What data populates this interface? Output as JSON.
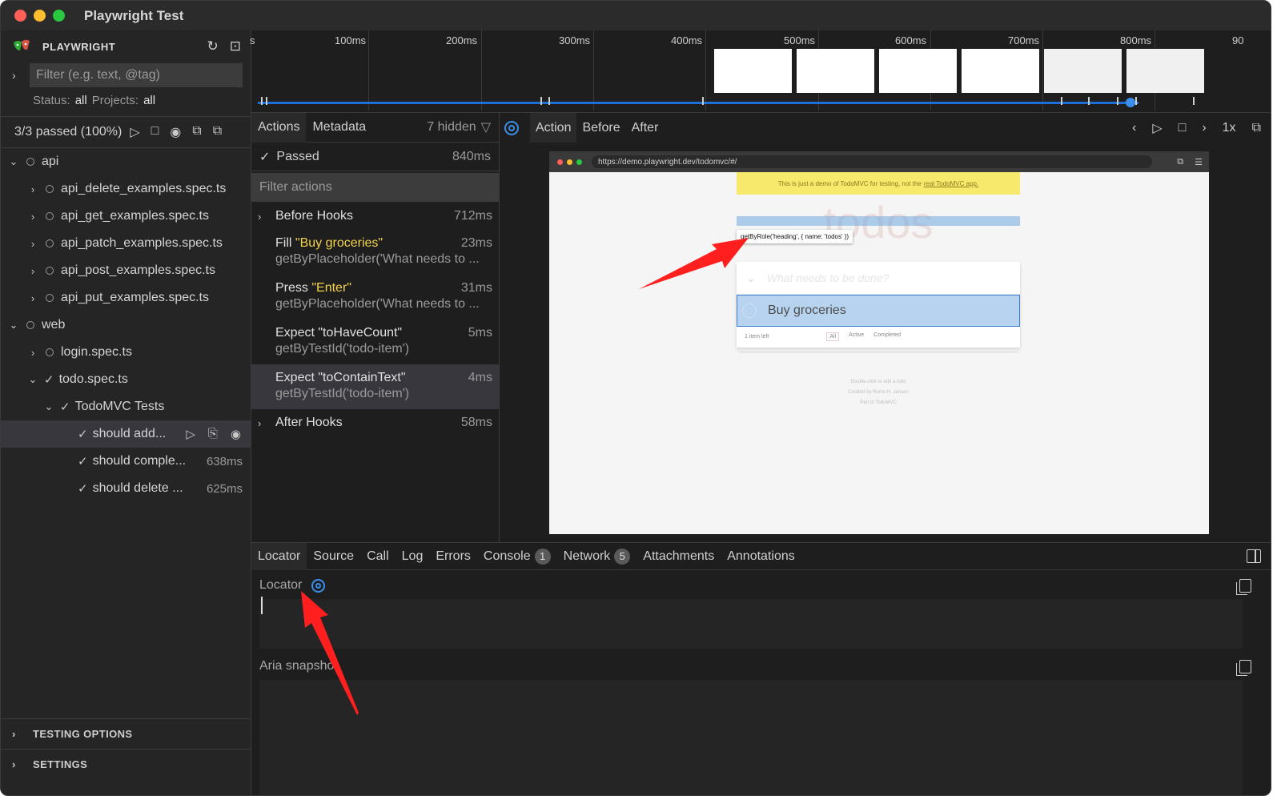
{
  "window": {
    "title": "Playwright Test"
  },
  "sidebar": {
    "brand": "PLAYWRIGHT",
    "filter_placeholder": "Filter (e.g. text, @tag)",
    "status_label": "Status:",
    "status_value": "all",
    "projects_label": "Projects:",
    "projects_value": "all",
    "summary": "3/3 passed (100%)",
    "tree": [
      {
        "label": "api",
        "kind": "folder"
      },
      {
        "label": "api_delete_examples.spec.ts",
        "kind": "file"
      },
      {
        "label": "api_get_examples.spec.ts",
        "kind": "file"
      },
      {
        "label": "api_patch_examples.spec.ts",
        "kind": "file"
      },
      {
        "label": "api_post_examples.spec.ts",
        "kind": "file"
      },
      {
        "label": "api_put_examples.spec.ts",
        "kind": "file"
      },
      {
        "label": "web",
        "kind": "folder"
      },
      {
        "label": "login.spec.ts",
        "kind": "file"
      },
      {
        "label": "todo.spec.ts",
        "kind": "file"
      },
      {
        "label": "TodoMVC Tests",
        "kind": "suite"
      },
      {
        "label": "should add...",
        "kind": "test",
        "selected": true
      },
      {
        "label": "should comple...",
        "kind": "test",
        "duration": "638ms"
      },
      {
        "label": "should delete ...",
        "kind": "test",
        "duration": "625ms"
      }
    ],
    "footer": [
      "TESTING OPTIONS",
      "SETTINGS"
    ]
  },
  "timeline": {
    "ticks": [
      "s",
      "100ms",
      "200ms",
      "300ms",
      "400ms",
      "500ms",
      "600ms",
      "700ms",
      "800ms",
      "90"
    ]
  },
  "actions_panel": {
    "tabs": [
      "Actions",
      "Metadata"
    ],
    "hidden_count": "7 hidden",
    "status": "Passed",
    "status_duration": "840ms",
    "filter_placeholder": "Filter actions",
    "before_hooks": {
      "label": "Before Hooks",
      "duration": "712ms"
    },
    "items": [
      {
        "prefix": "Fill ",
        "value": "\"Buy groceries\"",
        "duration": "23ms",
        "locator": "getByPlaceholder('What needs to ..."
      },
      {
        "prefix": "Press ",
        "value": "\"Enter\"",
        "duration": "31ms",
        "locator": "getByPlaceholder('What needs to ..."
      },
      {
        "prefix": "Expect \"toHaveCount\"",
        "value": "",
        "duration": "5ms",
        "locator": "getByTestId('todo-item')"
      },
      {
        "prefix": "Expect \"toContainText\"",
        "value": "",
        "duration": "4ms",
        "locator": "getByTestId('todo-item')"
      }
    ],
    "after_hooks": {
      "label": "After Hooks",
      "duration": "58ms"
    }
  },
  "snapshot": {
    "tabs": [
      "Action",
      "Before",
      "After"
    ],
    "speed": "1x",
    "url": "https://demo.playwright.dev/todomvc/#/",
    "banner_text": "This is just a demo of TodoMVC for testing, not the",
    "banner_link": "real TodoMVC app.",
    "todos_title": "todos",
    "tooltip": "getByRole('heading', { name: 'todos' })",
    "new_todo_placeholder": "What needs to be done?",
    "todo_item": "Buy groceries",
    "items_left": "1 item left",
    "filters": [
      "All",
      "Active",
      "Completed"
    ],
    "info_lines": [
      "Double-click to edit a todo",
      "Created by Remo H. Jansen",
      "Part of TodoMVC"
    ]
  },
  "details_panel": {
    "tabs": [
      "Locator",
      "Source",
      "Call",
      "Log",
      "Errors",
      "Console",
      "Network",
      "Attachments",
      "Annotations"
    ],
    "console_count": "1",
    "network_count": "5",
    "locator_label": "Locator",
    "aria_label": "Aria snapshot"
  },
  "colors": {
    "accent": "#3b8eea",
    "highlight": "#f2d34a",
    "annotation": "#ff1f1f"
  }
}
